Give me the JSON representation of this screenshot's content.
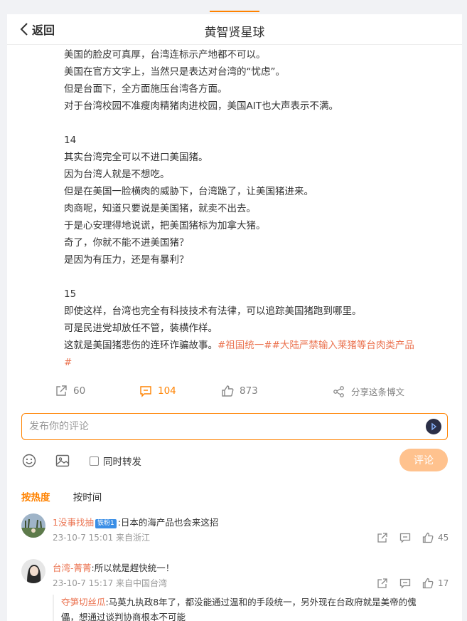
{
  "nav": {
    "back_label": "返回",
    "title": "黄智贤星球"
  },
  "post": {
    "lines": [
      "美国的脸皮可真厚，台湾连标示产地都不可以。",
      "美国在官方文字上，当然只是表达对台湾的“忧虑”。",
      "但是台面下，全方面施压台湾各方面。",
      "对于台湾校园不准瘦肉精猪肉进校园，美国AIT也大声表示不满。",
      "",
      "14",
      "其实台湾完全可以不进口美国猪。",
      "因为台湾人就是不想吃。",
      "但是在美国一脸横肉的威胁下，台湾跪了，让美国猪进来。",
      "肉商呢，知道只要说是美国猪，就卖不出去。",
      "于是心安理得地说谎，把美国猪标为加拿大猪。",
      "奇了，你就不能不进美国猪？",
      "是因为有压力，还是有暴利？",
      "",
      "15",
      "即使这样，台湾也完全有科技技术有法律，可以追踪美国猪跑到哪里。",
      "可是民进党却放任不管，装横作样。"
    ],
    "last_line_text": "这就是美国猪悲伤的连环诈骗故事。",
    "tag1": "#祖国统一#",
    "tag2": "#大陆严禁输入莱猪等台肉类产品",
    "tag2_end": "#"
  },
  "actions": {
    "share_count": "60",
    "comment_count": "104",
    "like_count": "873",
    "share_label": "分享这条博文"
  },
  "composer": {
    "placeholder": "发布你的评论",
    "forward_label": "同时转发",
    "submit_label": "评论"
  },
  "sort": {
    "hot": "按热度",
    "time": "按时间"
  },
  "comments": [
    {
      "user": "1没事找抽",
      "badge": "铁粉1",
      "text": ":日本的海产品也会来这招",
      "meta": "23-10-7 15:01 来自浙江",
      "likes": "45"
    },
    {
      "user": "台湾-菁菁",
      "text": ":所以就是趕快統一！",
      "meta": "23-10-7 15:17 来自中国台湾",
      "likes": "17"
    }
  ],
  "reply": {
    "user": "夺笋切丝瓜",
    "line1": ":马英九执政8年了，都没能通过温和的手段统一，另外现在台政府就是美帝的傀",
    "line2": "儡，想通过谈判协商根本不可能"
  },
  "colors": {
    "accent": "#ff8200",
    "link": "#eb7350"
  }
}
